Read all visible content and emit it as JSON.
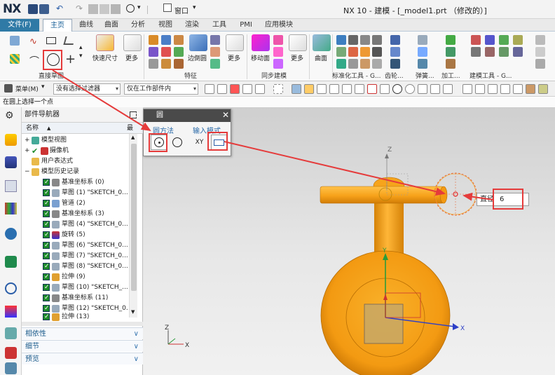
{
  "app": {
    "logo": "NX",
    "window_title": "NX 10 - 建模 - [_model1.prt （修改的）]",
    "window_menu": "窗口"
  },
  "ribbon": {
    "tabs": [
      "文件(F)",
      "主页",
      "曲线",
      "曲面",
      "分析",
      "视图",
      "渲染",
      "工具",
      "PMI",
      "应用模块"
    ],
    "active_tab": "主页",
    "buttons": {
      "quick_dimension": "快速尺寸",
      "more_1": "更多",
      "edge_blend": "边倒圆",
      "more_2": "更多",
      "move_face": "移动面",
      "more_3": "更多",
      "surface": "曲面"
    },
    "groups": {
      "direct_sketch": "直接草图",
      "feature": "特征",
      "sync_modeling": "同步建模",
      "standard_tools": "标准化工具 - G...",
      "gear": "齿轮...",
      "spring": "弹簧...",
      "machining": "加工...",
      "modeling_tools": "建模工具 - G..."
    }
  },
  "toolbar": {
    "menu": "菜单(M)",
    "selection_filter": "没有选择过滤器",
    "scope": "仅在工作部件内"
  },
  "prompt": "在圆上选择一个点",
  "navigator": {
    "title": "部件导航器",
    "col_name": "名称",
    "col_latest": "最",
    "items": [
      {
        "label": "模型视图",
        "indent": 0,
        "check": false
      },
      {
        "label": "摄像机",
        "indent": 0,
        "check": true
      },
      {
        "label": "用户表达式",
        "indent": 0,
        "check": false
      },
      {
        "label": "模型历史记录",
        "indent": 0,
        "check": false
      },
      {
        "label": "基准坐标系 (0)",
        "indent": 1,
        "check": true
      },
      {
        "label": "草图 (1) \"SKETCH_0...",
        "indent": 1,
        "check": true
      },
      {
        "label": "管道 (2)",
        "indent": 1,
        "check": true
      },
      {
        "label": "基准坐标系 (3)",
        "indent": 1,
        "check": true
      },
      {
        "label": "草图 (4) \"SKETCH_0...",
        "indent": 1,
        "check": true
      },
      {
        "label": "旋转 (5)",
        "indent": 1,
        "check": true
      },
      {
        "label": "草图 (6) \"SKETCH_0...",
        "indent": 1,
        "check": true
      },
      {
        "label": "草图 (7) \"SKETCH_0...",
        "indent": 1,
        "check": true
      },
      {
        "label": "草图 (8) \"SKETCH_0...",
        "indent": 1,
        "check": true
      },
      {
        "label": "拉伸 (9)",
        "indent": 1,
        "check": true
      },
      {
        "label": "草图 (10) \"SKETCH_...",
        "indent": 1,
        "check": true
      },
      {
        "label": "基准坐标系 (11)",
        "indent": 1,
        "check": true
      },
      {
        "label": "草图 (12) \"SKETCH_0...",
        "indent": 1,
        "check": true
      },
      {
        "label": "拉伸 (13)",
        "indent": 1,
        "check": true
      }
    ],
    "panels": [
      "相依性",
      "细节",
      "预览"
    ]
  },
  "dialog": {
    "title": "圆",
    "section_method": "圆方法",
    "section_input": "输入模式",
    "icon_xy": "XY"
  },
  "viewport": {
    "diameter_label": "直径",
    "diameter_value": "6",
    "axis_x": "X",
    "axis_y": "Y",
    "axis_z": "Z"
  },
  "colors": {
    "accent": "#e53b3b",
    "model_orange": "#f7a21a",
    "ribbon_blue": "#2f7aa6"
  }
}
